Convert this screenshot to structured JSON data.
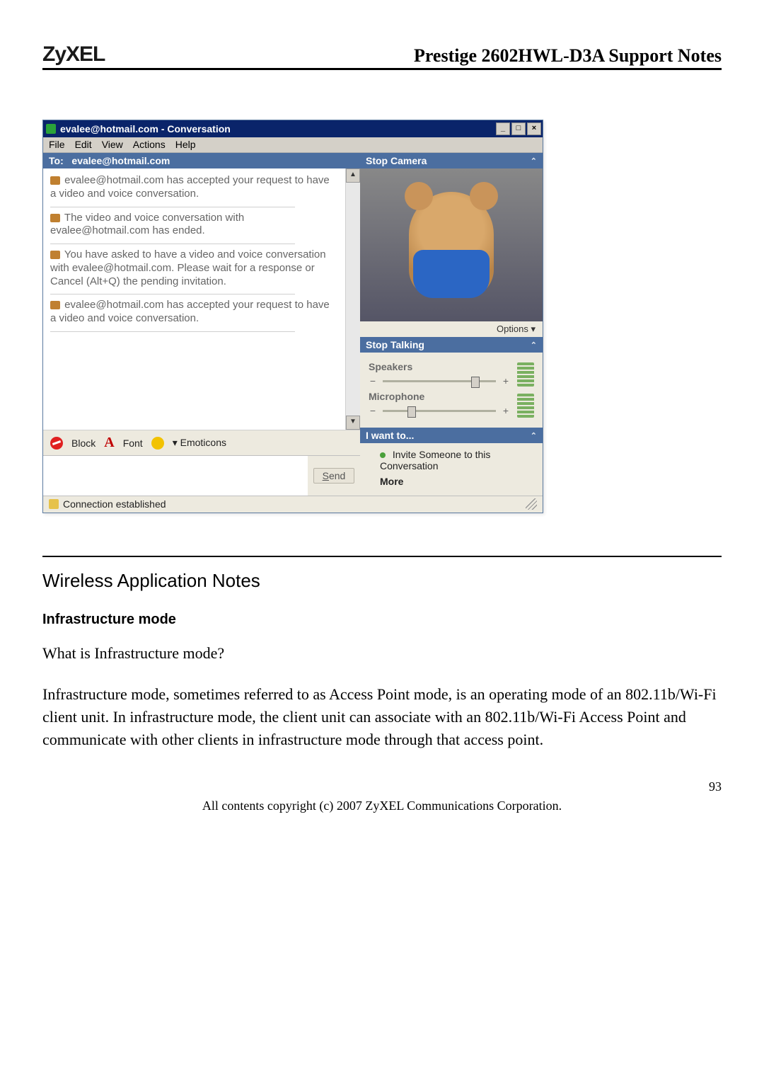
{
  "header": {
    "logo": "ZyXEL",
    "doc_title": "Prestige 2602HWL-D3A Support Notes"
  },
  "window": {
    "title": "evalee@hotmail.com - Conversation",
    "controls": {
      "min": "_",
      "max": "□",
      "close": "×"
    }
  },
  "menubar": [
    "File",
    "Edit",
    "View",
    "Actions",
    "Help"
  ],
  "to_bar": {
    "label": "To:",
    "value": "evalee@hotmail.com"
  },
  "conversation": {
    "msg1": "evalee@hotmail.com has accepted your request to have a video and voice conversation.",
    "msg2": "The video and voice conversation with evalee@hotmail.com has ended.",
    "msg3": "You have asked to have a video and voice conversation with evalee@hotmail.com. Please wait for a response or Cancel (Alt+Q) the pending invitation.",
    "msg4": "evalee@hotmail.com has accepted your request to have a video and voice conversation."
  },
  "toolbar": {
    "block": "Block",
    "font": "Font",
    "emoticons": "Emoticons"
  },
  "compose": {
    "send": "Send"
  },
  "right": {
    "stop_camera": "Stop Camera",
    "options": "Options ▾",
    "stop_talking": "Stop Talking",
    "speakers": "Speakers",
    "microphone": "Microphone",
    "i_want_to": "I want to...",
    "invite": "Invite Someone to this Conversation",
    "more": "More"
  },
  "statusbar": {
    "text": "Connection established"
  },
  "doc": {
    "section_title": "Wireless Application Notes",
    "subhead": "Infrastructure mode",
    "q": "What is Infrastructure mode?",
    "para": "Infrastructure mode, sometimes referred to as Access Point mode, is an operating mode of an 802.11b/Wi-Fi client unit. In infrastructure mode, the client unit can associate with an 802.11b/Wi-Fi Access Point and communicate with other clients in infrastructure mode through that access point.",
    "page_num": "93",
    "copyright": "All contents copyright (c) 2007 ZyXEL Communications Corporation."
  }
}
